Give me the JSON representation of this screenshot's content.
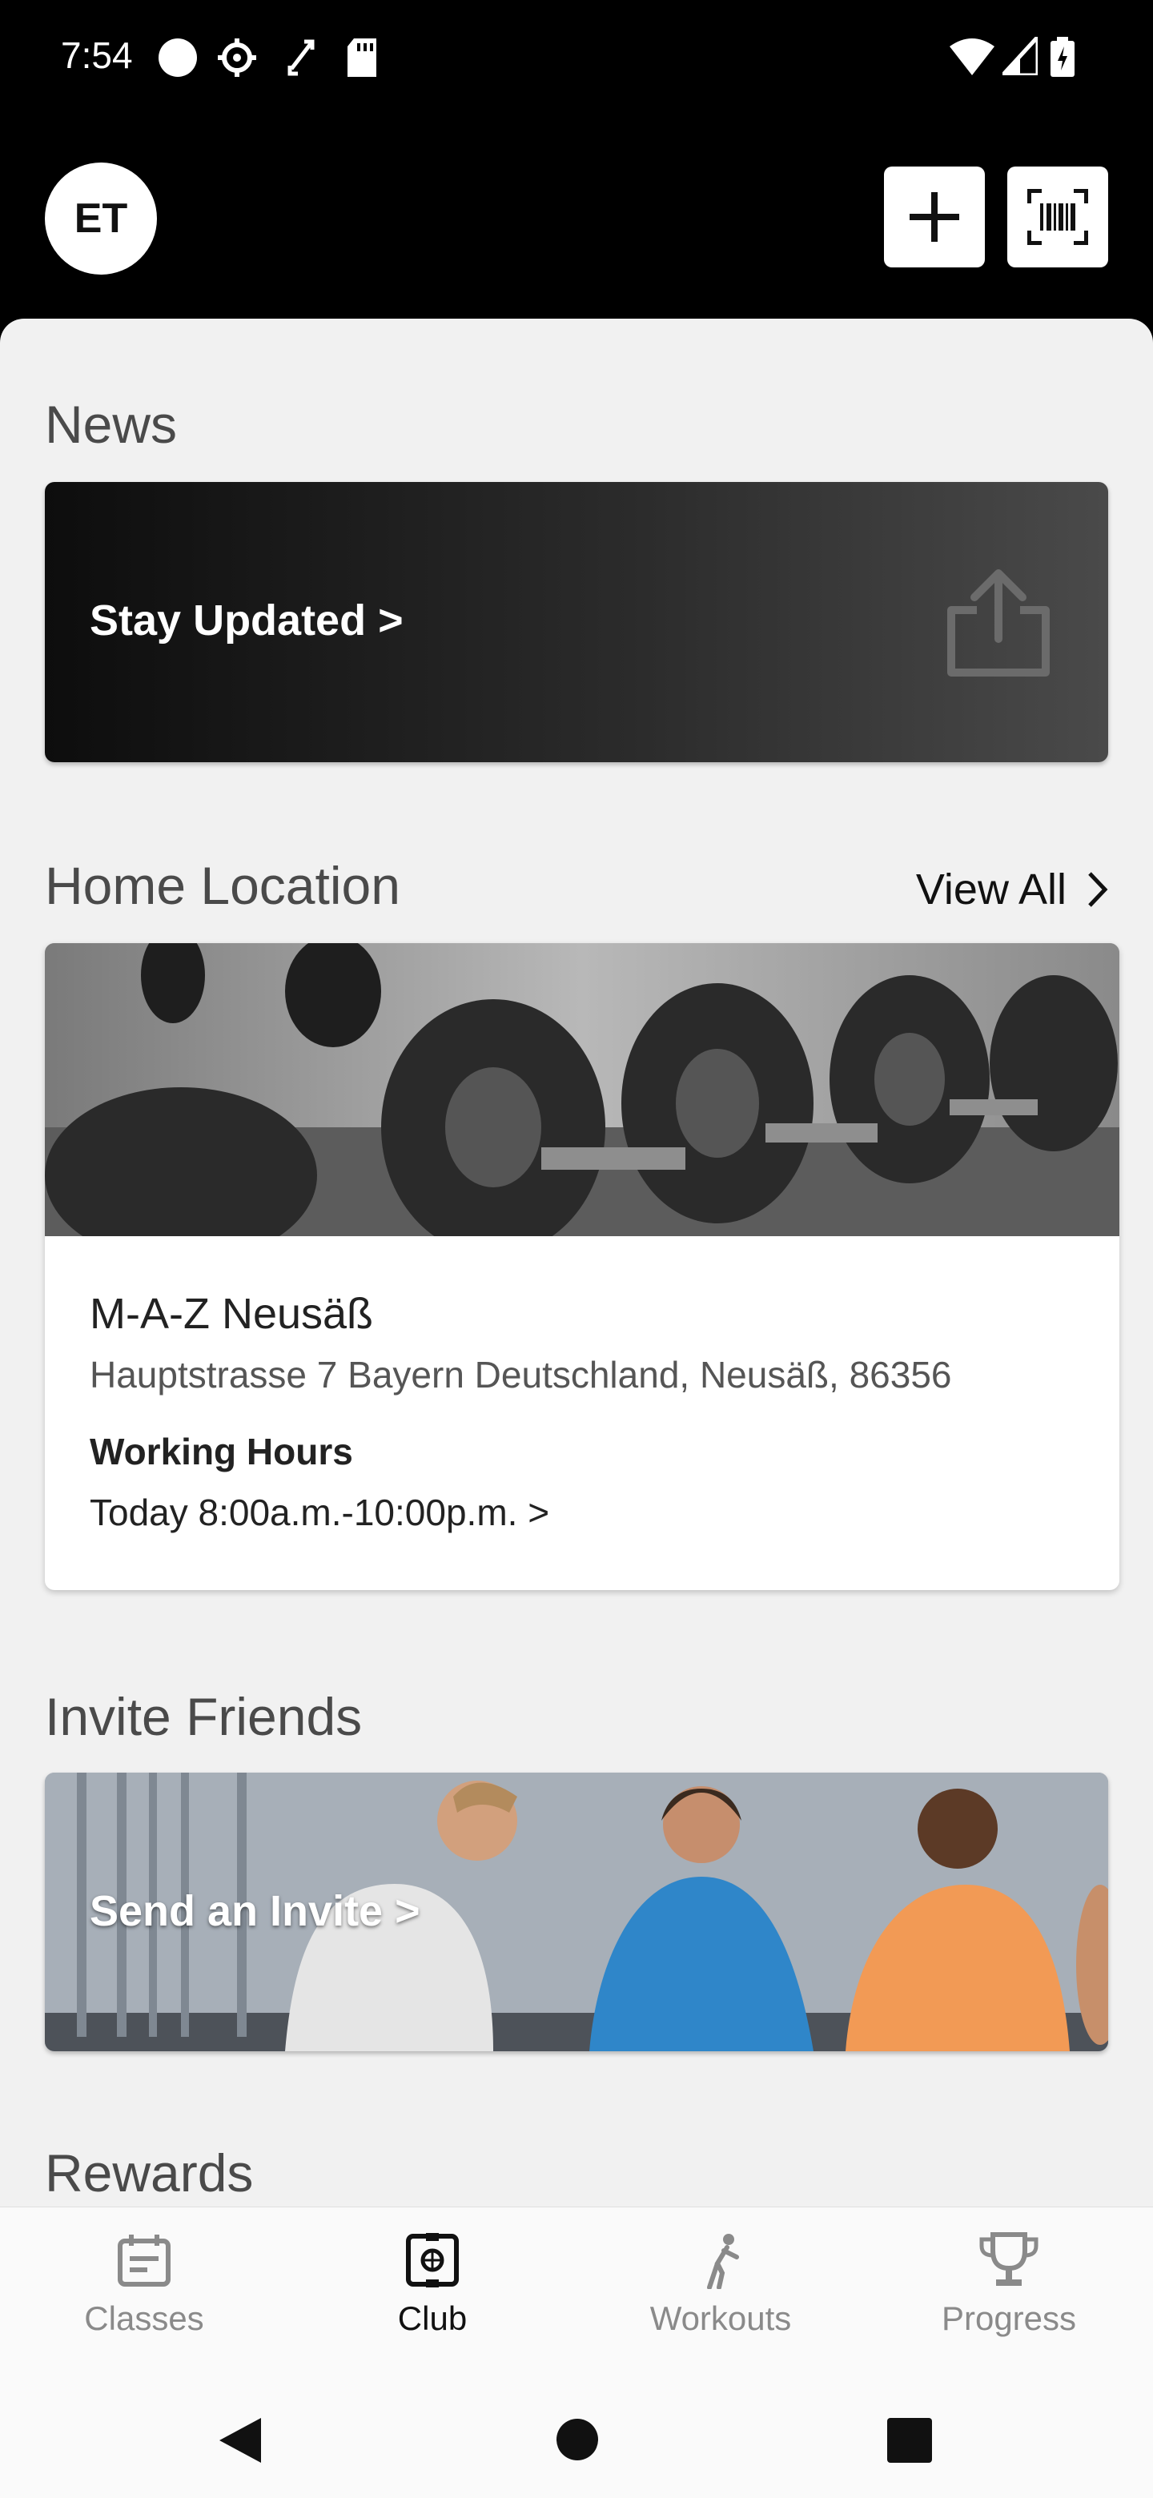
{
  "status_bar": {
    "time": "7:54"
  },
  "header": {
    "avatar_initials": "ET"
  },
  "news": {
    "title": "News",
    "banner_text": "Stay Updated >"
  },
  "home_location": {
    "title": "Home Location",
    "view_all": "View All",
    "club_name": "M-A-Z Neusäß",
    "address": "Hauptstrasse 7  Bayern Deutschland, Neusäß, 86356",
    "working_hours_label": "Working Hours",
    "today_hours": "Today 8:00a.m.-10:00p.m. >"
  },
  "invite": {
    "title": "Invite Friends",
    "banner_text": "Send an Invite >"
  },
  "rewards": {
    "title": "Rewards"
  },
  "bottom_nav": {
    "items": [
      {
        "label": "Classes",
        "icon": "calendar-icon"
      },
      {
        "label": "Club",
        "icon": "club-icon",
        "active": true
      },
      {
        "label": "Workouts",
        "icon": "runner-icon"
      },
      {
        "label": "Progress",
        "icon": "trophy-icon"
      }
    ]
  },
  "colors": {
    "background": "#f1f1f1",
    "header": "#000000",
    "active_nav": "#111111",
    "inactive_nav": "#8a8a8a"
  }
}
